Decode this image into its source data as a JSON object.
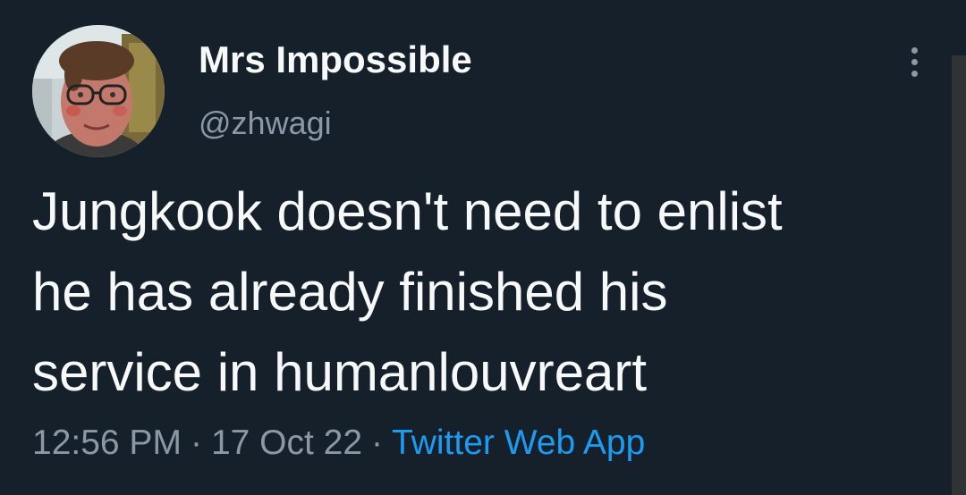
{
  "tweet": {
    "author": {
      "display_name": "Mrs Impossible",
      "handle": "@zhwagi"
    },
    "text_lines": [
      "Jungkook doesn't need to enlist",
      "he has already finished his",
      "service in humanlouvreart"
    ],
    "time": "12:56 PM",
    "separator": "·",
    "date": "17 Oct 22",
    "source": "Twitter Web App"
  },
  "icons": {
    "more": "more-vertical-icon"
  },
  "colors": {
    "background": "#15202b",
    "primary_text": "#f7f9f9",
    "secondary_text": "#8b98a5",
    "link": "#1d9bf0"
  }
}
